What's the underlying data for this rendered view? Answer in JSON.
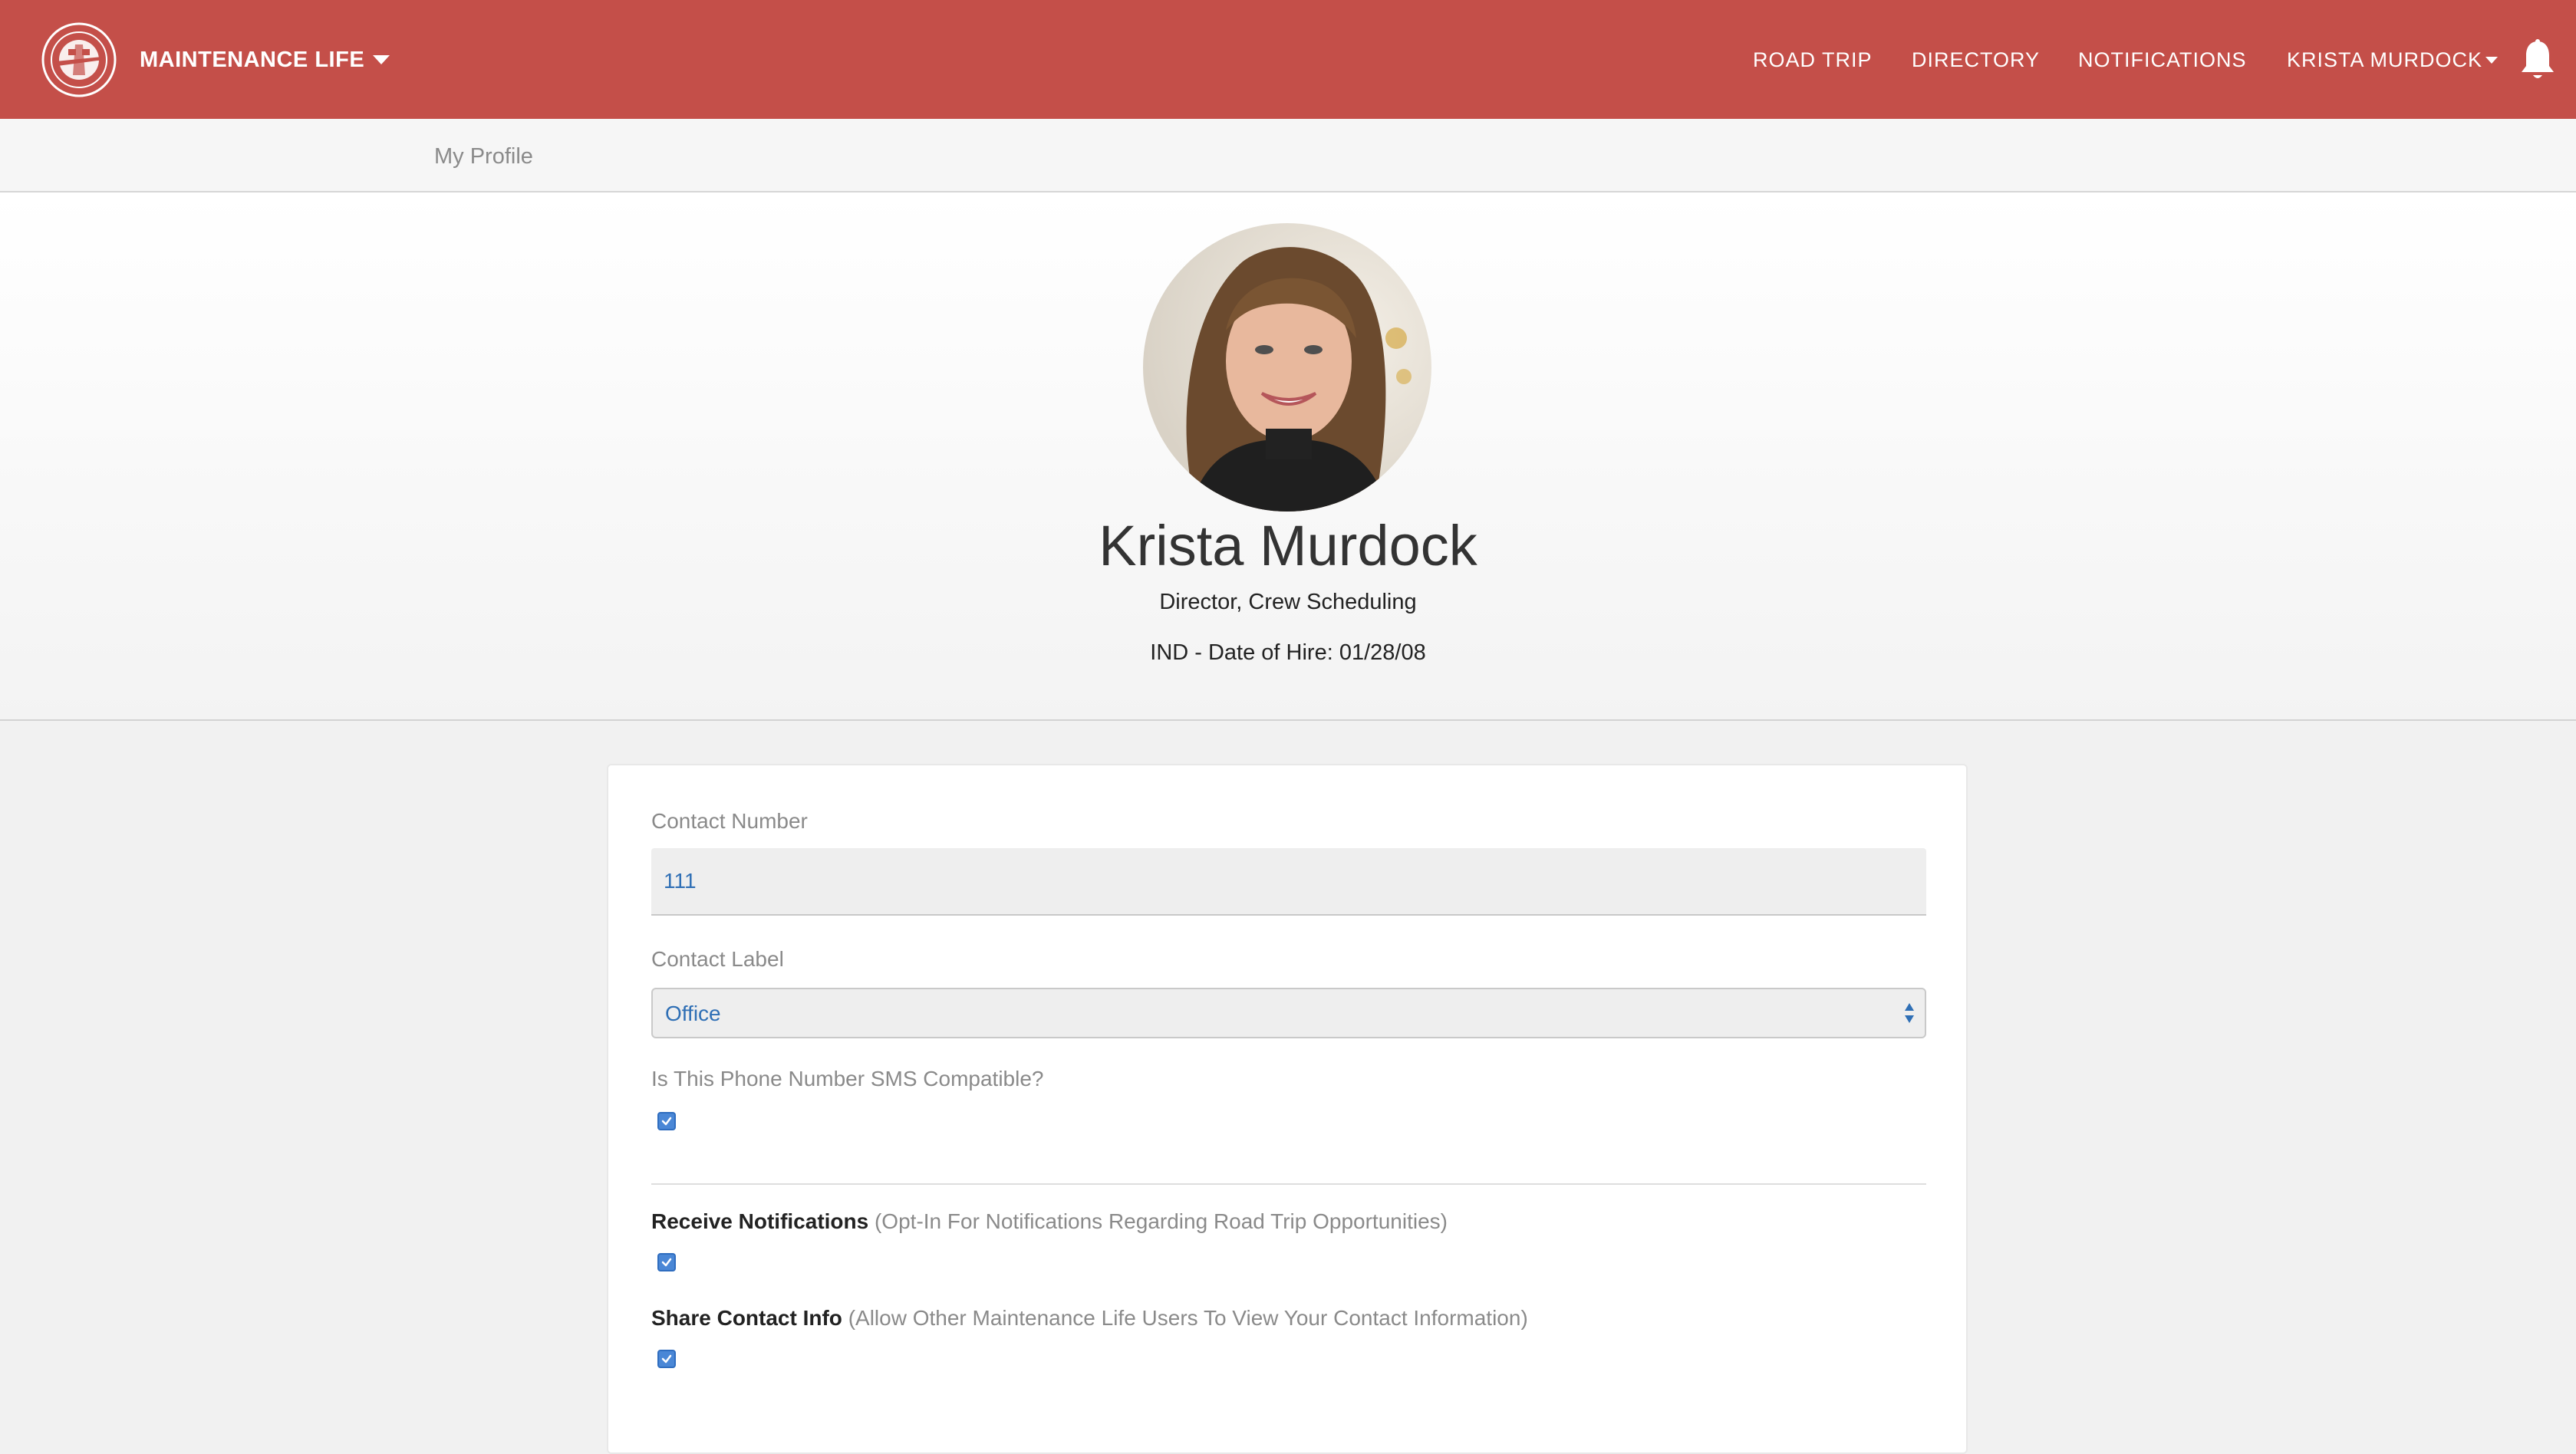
{
  "app": {
    "brand": "MAINTENANCE LIFE",
    "colors": {
      "header": "#c44f49",
      "accent": "#2f6fb5",
      "checkbox": "#4a87d6"
    }
  },
  "nav": {
    "road_trip": "ROAD TRIP",
    "directory": "DIRECTORY",
    "notifications": "NOTIFICATIONS",
    "user": "KRISTA MURDOCK",
    "bell_icon": "bell-icon"
  },
  "breadcrumb": {
    "current": "My Profile"
  },
  "profile": {
    "name": "Krista Murdock",
    "title": "Director, Crew Scheduling",
    "hire_info": "IND - Date of Hire: 01/28/08"
  },
  "form": {
    "contact_number": {
      "label": "Contact Number",
      "value": "111"
    },
    "contact_label": {
      "label": "Contact Label",
      "selected": "Office"
    },
    "sms": {
      "label": "Is This Phone Number SMS Compatible?",
      "checked": true
    },
    "receive_notifications": {
      "title": "Receive Notifications",
      "hint": "(Opt-In For Notifications Regarding Road Trip Opportunities)",
      "checked": true
    },
    "share_contact": {
      "title": "Share Contact Info",
      "hint": "(Allow Other Maintenance Life Users To View Your Contact Information)",
      "checked": true
    }
  }
}
